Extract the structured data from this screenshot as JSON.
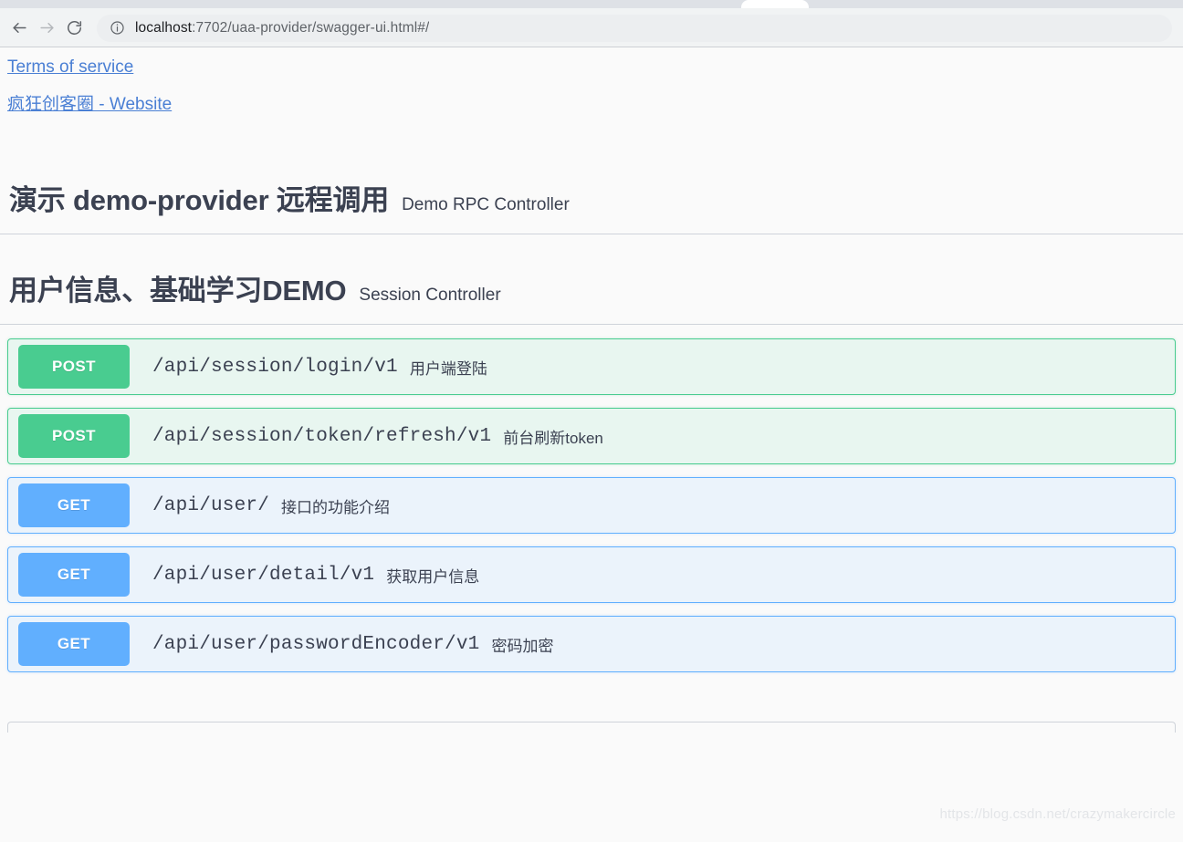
{
  "browser": {
    "back_icon": "back-arrow-icon",
    "forward_icon": "forward-arrow-icon",
    "reload_icon": "reload-icon",
    "site_info_icon": "info-circle-icon",
    "url_host": "localhost",
    "url_rest": ":7702/uaa-provider/swagger-ui.html#/"
  },
  "info": {
    "terms_link": "Terms of service",
    "website_link": "疯狂创客圈 - Website"
  },
  "tags": [
    {
      "title": "演示 demo-provider 远程调用",
      "description": "Demo RPC Controller",
      "operations": []
    },
    {
      "title": "用户信息、基础学习DEMO",
      "description": "Session Controller",
      "operations": [
        {
          "method": "POST",
          "path": "/api/session/login/v1",
          "summary": "用户端登陆"
        },
        {
          "method": "POST",
          "path": "/api/session/token/refresh/v1",
          "summary": "前台刷新token"
        },
        {
          "method": "GET",
          "path": "/api/user/",
          "summary": "接口的功能介绍"
        },
        {
          "method": "GET",
          "path": "/api/user/detail/v1",
          "summary": "获取用户信息"
        },
        {
          "method": "GET",
          "path": "/api/user/passwordEncoder/v1",
          "summary": "密码加密"
        }
      ]
    }
  ],
  "colors": {
    "post": "#49cc90",
    "post_bg": "#e8f6f0",
    "get": "#61affe",
    "get_bg": "#ebf3fb",
    "link": "#4a7fd4",
    "text": "#3b4151"
  },
  "watermark": "https://blog.csdn.net/crazymakercircle"
}
